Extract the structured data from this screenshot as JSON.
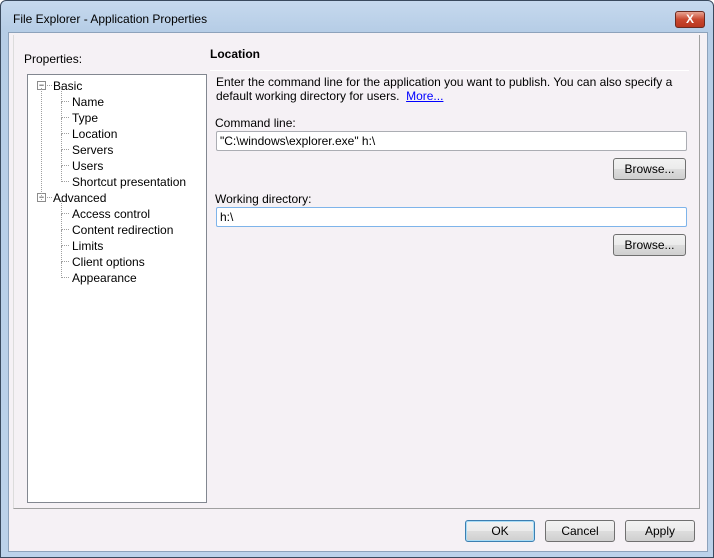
{
  "window": {
    "title": "File Explorer - Application Properties",
    "close_label": "X"
  },
  "properties_label": "Properties:",
  "tree": [
    {
      "label": "Basic",
      "level": 0,
      "expander": "−"
    },
    {
      "label": "Name",
      "level": 1
    },
    {
      "label": "Type",
      "level": 1
    },
    {
      "label": "Location",
      "level": 1
    },
    {
      "label": "Servers",
      "level": 1
    },
    {
      "label": "Users",
      "level": 1
    },
    {
      "label": "Shortcut presentation",
      "level": 1
    },
    {
      "label": "Advanced",
      "level": 0,
      "expander": "−"
    },
    {
      "label": "Access control",
      "level": 1
    },
    {
      "label": "Content redirection",
      "level": 1
    },
    {
      "label": "Limits",
      "level": 1
    },
    {
      "label": "Client options",
      "level": 1
    },
    {
      "label": "Appearance",
      "level": 1
    }
  ],
  "section": {
    "title": "Location",
    "description_line1": "Enter the command line for the application you want to publish.  You can also specify a",
    "description_line2": "default working directory for users.",
    "more_link": "More..."
  },
  "command_line": {
    "label": "Command line:",
    "value": "\"C:\\windows\\explorer.exe\" h:\\",
    "browse": "Browse..."
  },
  "working_directory": {
    "label": "Working directory:",
    "value": "h:\\",
    "browse": "Browse..."
  },
  "buttons": {
    "ok": "OK",
    "cancel": "Cancel",
    "apply": "Apply"
  }
}
